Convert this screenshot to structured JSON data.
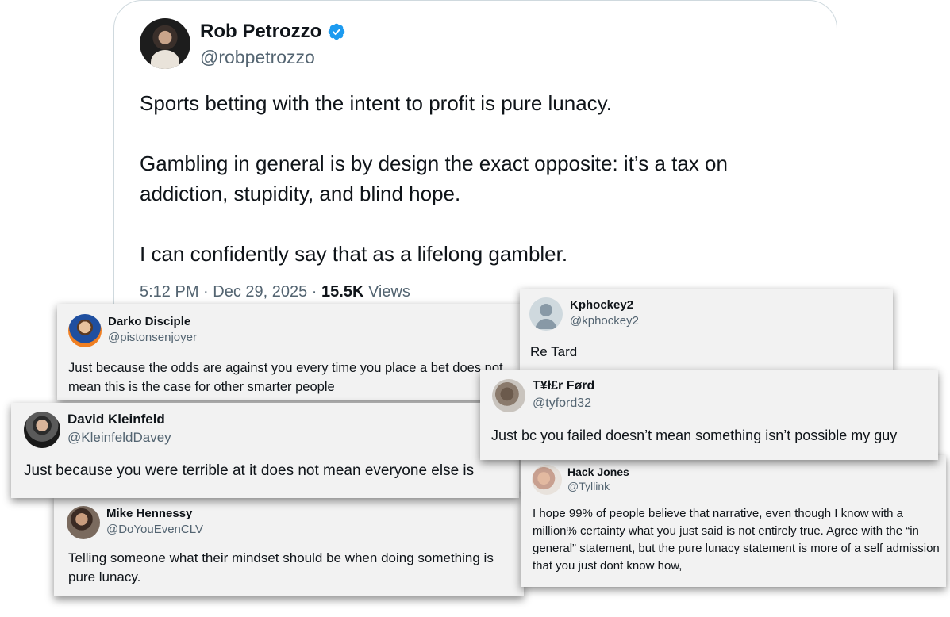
{
  "main_tweet": {
    "name": "Rob Petrozzo",
    "handle": "@robpetrozzo",
    "paragraphs": [
      "Sports betting with the intent to profit is pure lunacy.",
      "Gambling in general is by design the exact opposite: it’s a tax on addiction, stupidity, and blind hope.",
      "I can confidently say that as a lifelong gambler."
    ],
    "time": "5:12 PM · Dec 29, 2025 · ",
    "views_count": "15.5K",
    "views_label": " Views",
    "verified_color": "#1d9bf0"
  },
  "replies": {
    "kphockey": {
      "name": "Kphockey2",
      "handle": "@kphockey2",
      "text": "Re Tard"
    },
    "darko": {
      "name": "Darko Disciple",
      "handle": "@pistonsenjoyer",
      "text": "Just because the odds are against you  every time you place a bet does not mean this is the case for other smarter people"
    },
    "tyler": {
      "name": "T¥ł£r Førd",
      "handle": "@tyford32",
      "text": "Just bc you failed doesn’t mean something isn’t possible my guy"
    },
    "david": {
      "name": "David Kleinfeld",
      "handle": "@KleinfeldDavey",
      "text": "Just because you were terrible at it does not mean everyone else is"
    },
    "hack": {
      "name": "Hack Jones",
      "handle": "@Tyllink",
      "text": "I hope 99% of people believe that narrative, even though I know with a million% certainty what you just said is not entirely true.  Agree with the “in general” statement, but the pure lunacy statement is more of a self admission that you just dont know how,"
    },
    "mike": {
      "name": "Mike Hennessy",
      "handle": "@DoYouEvenCLV",
      "text": "Telling someone what their mindset should be when doing something is pure lunacy."
    }
  }
}
